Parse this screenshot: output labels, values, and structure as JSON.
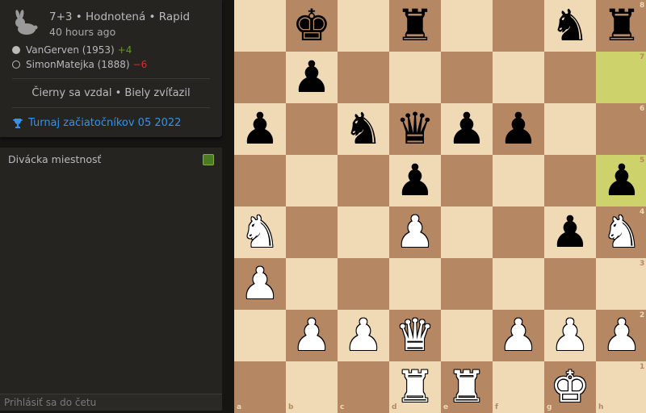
{
  "game": {
    "title": "7+3 • Hodnotená • Rapid",
    "time_ago": "40 hours ago",
    "players": [
      {
        "color": "white",
        "name": "VanGerven (1953)",
        "delta": "+4"
      },
      {
        "color": "black",
        "name": "SimonMatejka (1888)",
        "delta": "−6"
      }
    ],
    "result": "Čierny sa vzdal • Biely zvíťazil",
    "tournament": "Turnaj začiatočníkov 05 2022",
    "icon": "rabbit-icon"
  },
  "chat": {
    "title": "Divácka miestnosť",
    "input_placeholder": "Prihlásiť sa do četu",
    "toggle_color": "#4c7a22"
  },
  "board": {
    "colors": {
      "light": "#f0d9b5",
      "dark": "#b58863",
      "highlight": "#cdd26a"
    },
    "files": [
      "a",
      "b",
      "c",
      "d",
      "e",
      "f",
      "g",
      "h"
    ],
    "ranks": [
      "8",
      "7",
      "6",
      "5",
      "4",
      "3",
      "2",
      "1"
    ],
    "highlighted": [
      "h7",
      "h5"
    ],
    "pieces": [
      {
        "sq": "b8",
        "p": "bK"
      },
      {
        "sq": "d8",
        "p": "bR"
      },
      {
        "sq": "g8",
        "p": "bN"
      },
      {
        "sq": "h8",
        "p": "bR"
      },
      {
        "sq": "b7",
        "p": "bP"
      },
      {
        "sq": "a6",
        "p": "bP"
      },
      {
        "sq": "c6",
        "p": "bN"
      },
      {
        "sq": "d6",
        "p": "bQ"
      },
      {
        "sq": "e6",
        "p": "bP"
      },
      {
        "sq": "f6",
        "p": "bP"
      },
      {
        "sq": "d5",
        "p": "bP"
      },
      {
        "sq": "h5",
        "p": "bP"
      },
      {
        "sq": "a4",
        "p": "wN"
      },
      {
        "sq": "d4",
        "p": "wP"
      },
      {
        "sq": "g4",
        "p": "bP"
      },
      {
        "sq": "h4",
        "p": "wN"
      },
      {
        "sq": "a3",
        "p": "wP"
      },
      {
        "sq": "b2",
        "p": "wP"
      },
      {
        "sq": "c2",
        "p": "wP"
      },
      {
        "sq": "d2",
        "p": "wQ"
      },
      {
        "sq": "f2",
        "p": "wP"
      },
      {
        "sq": "g2",
        "p": "wP"
      },
      {
        "sq": "h2",
        "p": "wP"
      },
      {
        "sq": "d1",
        "p": "wR"
      },
      {
        "sq": "e1",
        "p": "wR"
      },
      {
        "sq": "g1",
        "p": "wK"
      }
    ]
  }
}
